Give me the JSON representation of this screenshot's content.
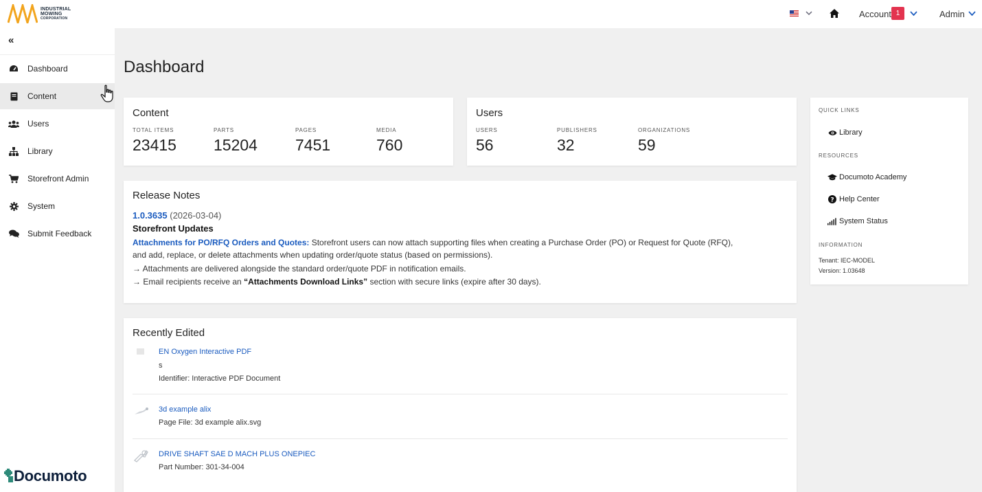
{
  "brand": {
    "company_name_line1": "INDUSTRIAL",
    "company_name_line2": "MOWING",
    "company_name_line3": "CORPORATION",
    "footer_logo_text": "Documoto",
    "accent_color": "#f2a41c",
    "link_color": "#1a5bbf",
    "badge_color": "#e3334f"
  },
  "header": {
    "language_flag": "us-flag-icon",
    "account_label": "Account",
    "account_badge": "1",
    "admin_label": "Admin"
  },
  "sidebar": {
    "collapse_glyph": "«",
    "items": [
      {
        "label": "Dashboard",
        "icon": "dashboard-icon"
      },
      {
        "label": "Content",
        "icon": "book-icon"
      },
      {
        "label": "Users",
        "icon": "users-icon"
      },
      {
        "label": "Library",
        "icon": "sitemap-icon"
      },
      {
        "label": "Storefront Admin",
        "icon": "cart-icon"
      },
      {
        "label": "System",
        "icon": "gear-icon"
      },
      {
        "label": "Submit Feedback",
        "icon": "comments-icon"
      }
    ]
  },
  "main": {
    "title": "Dashboard",
    "content_card": {
      "title": "Content",
      "stats": [
        {
          "label": "TOTAL ITEMS",
          "value": "23415"
        },
        {
          "label": "PARTS",
          "value": "15204"
        },
        {
          "label": "PAGES",
          "value": "7451"
        },
        {
          "label": "MEDIA",
          "value": "760"
        }
      ]
    },
    "users_card": {
      "title": "Users",
      "stats": [
        {
          "label": "USERS",
          "value": "56"
        },
        {
          "label": "PUBLISHERS",
          "value": "32"
        },
        {
          "label": "ORGANIZATIONS",
          "value": "59"
        }
      ]
    },
    "release_notes": {
      "title": "Release Notes",
      "version": "1.0.3635",
      "date": "(2026-03-04)",
      "heading": "Storefront Updates",
      "feature_title": "Attachments for PO/RFQ Orders and Quotes:",
      "feature_text": " Storefront users can now attach supporting files when creating a Purchase Order (PO) or Request for Quote (RFQ),",
      "feature_text_2": "and add, replace, or delete attachments when updating order/quote status (based on permissions).",
      "bullet_1": "→ Attachments are delivered alongside the standard order/quote PDF in notification emails.",
      "bullet_2_pre": "→ Email recipients receive an ",
      "bullet_2_bold": "“Attachments Download Links”",
      "bullet_2_post": " section with secure links (expire after 30 days)."
    },
    "recently_edited": {
      "title": "Recently Edited",
      "items": [
        {
          "name": "EN Oxygen Interactive PDF",
          "line2": "s",
          "line3": "Identifier: Interactive PDF Document"
        },
        {
          "name": "3d example alix",
          "line2": "Page File: 3d example alix.svg"
        },
        {
          "name": "DRIVE SHAFT SAE D MACH PLUS ONEPIEC",
          "line2": "Part Number: 301-34-004"
        }
      ]
    }
  },
  "right_panel": {
    "quick_links_heading": "QUICK LINKS",
    "quick_links": [
      {
        "label": "Library",
        "icon": "eye-icon"
      }
    ],
    "resources_heading": "RESOURCES",
    "resources": [
      {
        "label": "Documoto Academy",
        "icon": "graduation-cap-icon"
      },
      {
        "label": "Help Center",
        "icon": "question-circle-icon"
      },
      {
        "label": "System Status",
        "icon": "signal-icon"
      }
    ],
    "information_heading": "INFORMATION",
    "tenant": "Tenant: IEC-MODEL",
    "version": "Version: 1.03648"
  }
}
